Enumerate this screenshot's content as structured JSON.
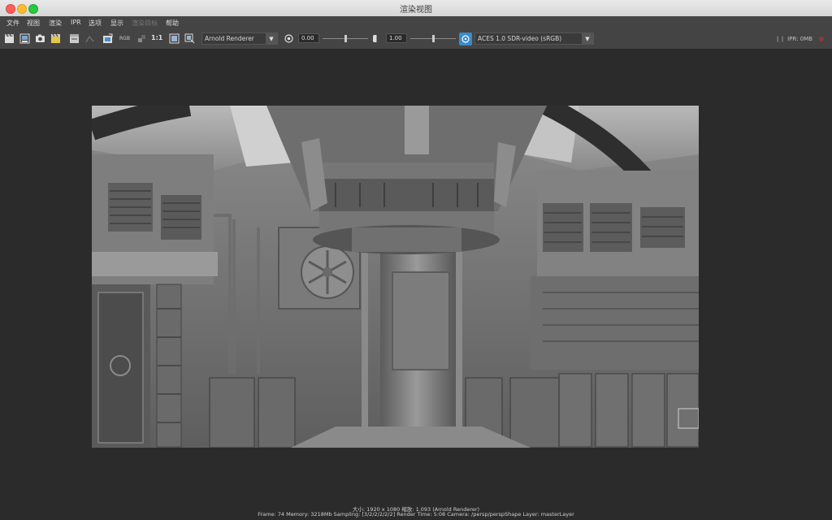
{
  "window": {
    "title": "渲染视图"
  },
  "menu": [
    "文件",
    "视图",
    "渲染",
    "IPR",
    "选项",
    "显示",
    "渲染目标",
    "帮助"
  ],
  "menu_disabled_index": 6,
  "toolbar": {
    "renderer": "Arnold Renderer",
    "exposure_value": "0.00",
    "gamma_value": "1.00",
    "exposure_slider_level": 0.5,
    "gamma_slider_level": 0.5,
    "colorspace": "ACES 1.0 SDR-video (sRGB)",
    "rgb_label": "RGB",
    "ratio_label": "1:1",
    "ipr_memory": "IPR: 0MB",
    "icons": [
      "render-clapboard-icon",
      "render-region-icon",
      "snapshot-icon",
      "ipr-render-icon",
      "redo-render-icon",
      "render-region-dim-icon",
      "keep-image-icon",
      "rgb-channels-icon",
      "remove-image-icon",
      "real-size-icon",
      "frame-image-icon",
      "frame-region-icon",
      "exposure-icon",
      "gamma-icon",
      "color-management-icon"
    ]
  },
  "status": {
    "line1": "大小: 1920 x 1080 缩放: 1.093      (Arnold Renderer)",
    "line2": "Frame: 74     Memory: 3218Mb     Sampling: [3/2/2/2/2/2]     Render Time: 5:08     Camera: /persp/perspShape     Layer: masterLayer"
  },
  "colors": {
    "accent": "#3b8bc9",
    "background": "#2b2b2b",
    "toolbar": "#444444"
  }
}
